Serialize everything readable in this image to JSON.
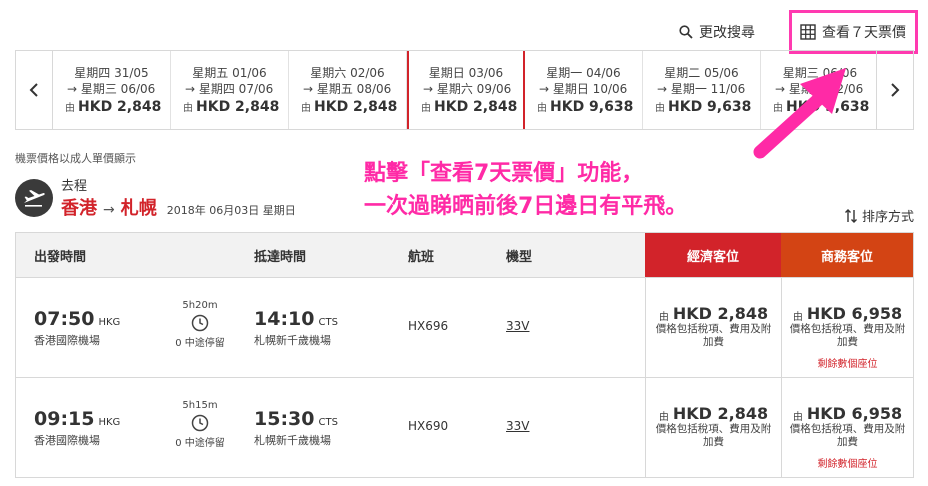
{
  "top": {
    "modify_search": "更改搜尋",
    "view_week_fares": "查看７天票價"
  },
  "dates": [
    {
      "d1": "星期四 31/05",
      "d2": "→ 星期三 06/06",
      "from": "由",
      "price": "HKD 2,848"
    },
    {
      "d1": "星期五 01/06",
      "d2": "→ 星期四 07/06",
      "from": "由",
      "price": "HKD 2,848"
    },
    {
      "d1": "星期六 02/06",
      "d2": "→ 星期五 08/06",
      "from": "由",
      "price": "HKD 2,848"
    },
    {
      "d1": "星期日 03/06",
      "d2": "→ 星期六 09/06",
      "from": "由",
      "price": "HKD 2,848"
    },
    {
      "d1": "星期一 04/06",
      "d2": "→ 星期日 10/06",
      "from": "由",
      "price": "HKD 9,638"
    },
    {
      "d1": "星期二 05/06",
      "d2": "→ 星期一 11/06",
      "from": "由",
      "price": "HKD 9,638"
    },
    {
      "d1": "星期三 06/06",
      "d2": "→ 星期二 12/06",
      "from": "由",
      "price": "HKD 9,638"
    }
  ],
  "note": "機票價格以成人單價顯示",
  "route": {
    "direction": "去程",
    "origin": "香港",
    "destination": "札幌",
    "date": "2018年 06月03日 星期日"
  },
  "overlay": {
    "line1": "點擊「查看7天票價」功能，",
    "line2": "一次過睇晒前後7日邊日有平飛。"
  },
  "sort_label": "排序方式",
  "table": {
    "headers": {
      "departure": "出發時間",
      "arrival": "抵達時間",
      "flight": "航班",
      "aircraft": "機型",
      "economy": "經濟客位",
      "business": "商務客位"
    },
    "rows": [
      {
        "dep_time": "07:50",
        "dep_code": "HKG",
        "dep_airport": "香港國際機場",
        "duration": "5h20m",
        "stops": "0 中途停留",
        "arr_time": "14:10",
        "arr_code": "CTS",
        "arr_airport": "札幌新千歲機場",
        "flight": "HX696",
        "aircraft": "33V",
        "eco_from": "由",
        "eco_price": "HKD 2,848",
        "eco_note": "價格包括稅項、費用及附加費",
        "bus_from": "由",
        "bus_price": "HKD 6,958",
        "bus_note": "價格包括稅項、費用及附加費",
        "bus_seats": "剩餘數個座位"
      },
      {
        "dep_time": "09:15",
        "dep_code": "HKG",
        "dep_airport": "香港國際機場",
        "duration": "5h15m",
        "stops": "0 中途停留",
        "arr_time": "15:30",
        "arr_code": "CTS",
        "arr_airport": "札幌新千歲機場",
        "flight": "HX690",
        "aircraft": "33V",
        "eco_from": "由",
        "eco_price": "HKD 2,848",
        "eco_note": "價格包括稅項、費用及附加費",
        "bus_from": "由",
        "bus_price": "HKD 6,958",
        "bus_note": "價格包括稅項、費用及附加費",
        "bus_seats": "剩餘數個座位"
      }
    ]
  },
  "colors": {
    "brand_red": "#d2232a",
    "business_orange": "#d34414",
    "highlight_pink": "#ff2aa6"
  }
}
